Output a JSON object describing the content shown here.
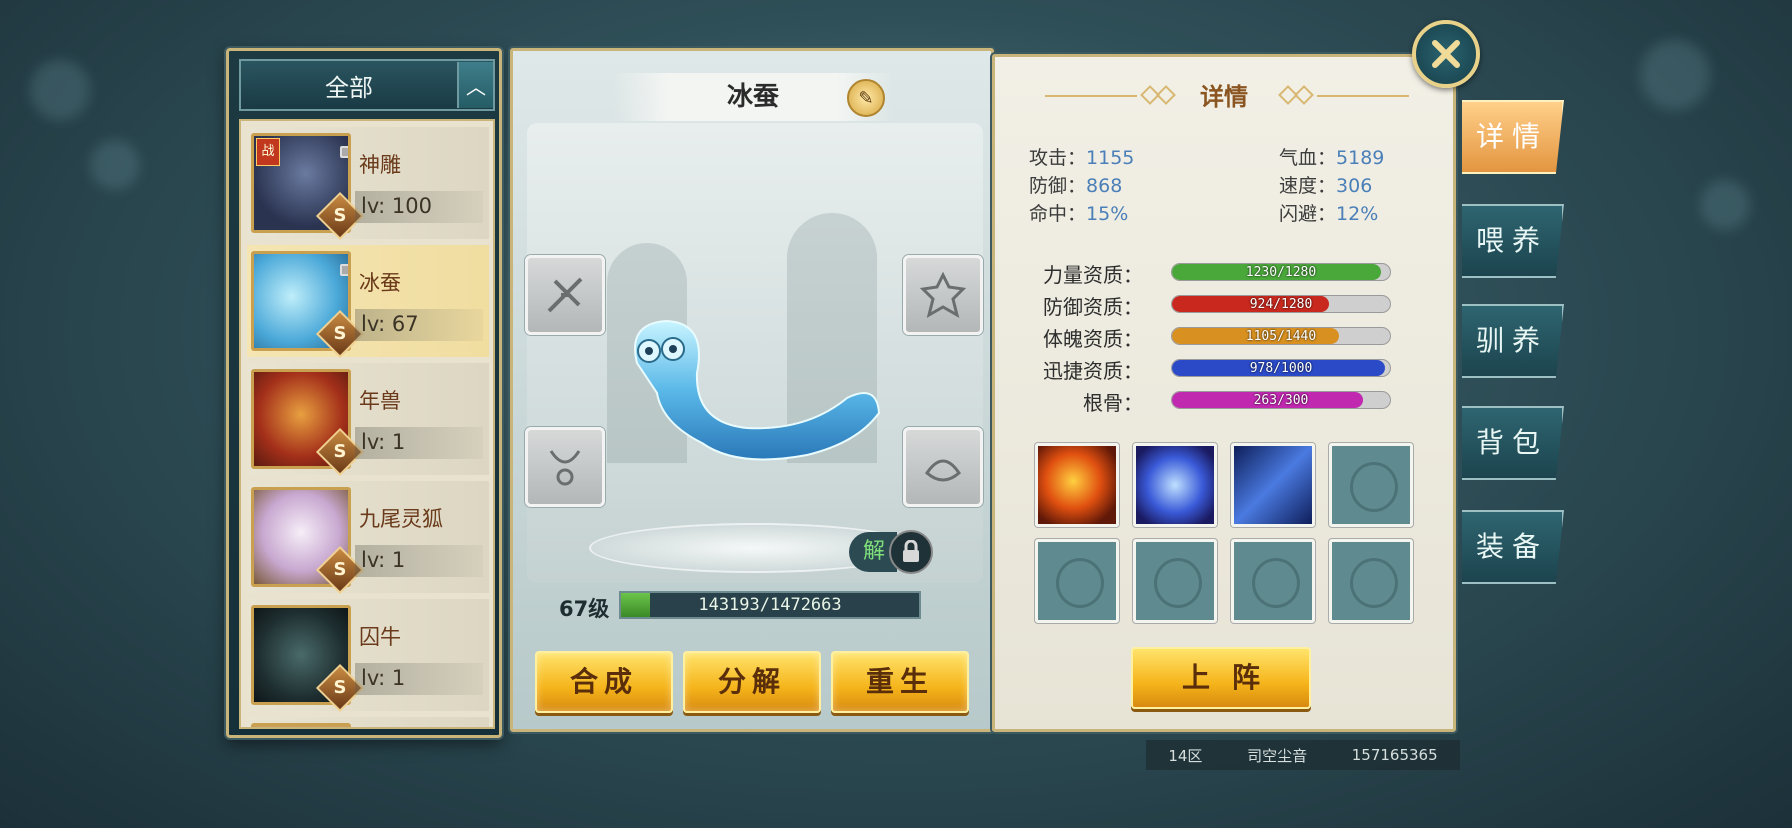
{
  "list": {
    "filter_label": "全部",
    "toggle_icon": "chevron-up-icon",
    "pets": [
      {
        "name": "神雕",
        "level_text": "lv: 100",
        "grade": "S",
        "tag": "战",
        "selected": false
      },
      {
        "name": "冰蚕",
        "level_text": "lv: 67",
        "grade": "S",
        "tag": "",
        "selected": true
      },
      {
        "name": "年兽",
        "level_text": "lv: 1",
        "grade": "S",
        "tag": "",
        "selected": false
      },
      {
        "name": "九尾灵狐",
        "level_text": "lv: 1",
        "grade": "S",
        "tag": "",
        "selected": false
      },
      {
        "name": "囚牛",
        "level_text": "lv: 1",
        "grade": "S",
        "tag": "",
        "selected": false
      }
    ]
  },
  "pet": {
    "name": "冰蚕",
    "level_label": "67级",
    "exp_text": "143193/1472663",
    "exp_fraction": 0.097,
    "unlock_label": "解"
  },
  "actions": {
    "compose": "合成",
    "decompose": "分解",
    "rebirth": "重生",
    "deploy": "上阵"
  },
  "details": {
    "heading": "详情",
    "stats": [
      {
        "label": "攻击：",
        "value": "1155"
      },
      {
        "label": "气血：",
        "value": "5189"
      },
      {
        "label": "防御：",
        "value": "868"
      },
      {
        "label": "速度：",
        "value": "306"
      },
      {
        "label": "命中：",
        "value": "15%"
      },
      {
        "label": "闪避：",
        "value": "12%"
      }
    ],
    "aptitudes": [
      {
        "label": "力量资质：",
        "text": "1230/1280",
        "fraction": 0.961,
        "color": "#4aa83a"
      },
      {
        "label": "防御资质：",
        "text": "924/1280",
        "fraction": 0.722,
        "color": "#c8281e"
      },
      {
        "label": "体魄资质：",
        "text": "1105/1440",
        "fraction": 0.767,
        "color": "#d89020"
      },
      {
        "label": "迅捷资质：",
        "text": "978/1000",
        "fraction": 0.978,
        "color": "#2a4ac8"
      },
      {
        "label": "根骨：",
        "text": "263/300",
        "fraction": 0.877,
        "color": "#c028b0"
      }
    ]
  },
  "tabs": [
    {
      "label": "详情",
      "active": true
    },
    {
      "label": "喂养",
      "active": false
    },
    {
      "label": "驯养",
      "active": false
    },
    {
      "label": "背包",
      "active": false
    },
    {
      "label": "装备",
      "active": false
    }
  ],
  "footer": {
    "server": "14区",
    "player": "司空尘音",
    "id": "157165365"
  }
}
